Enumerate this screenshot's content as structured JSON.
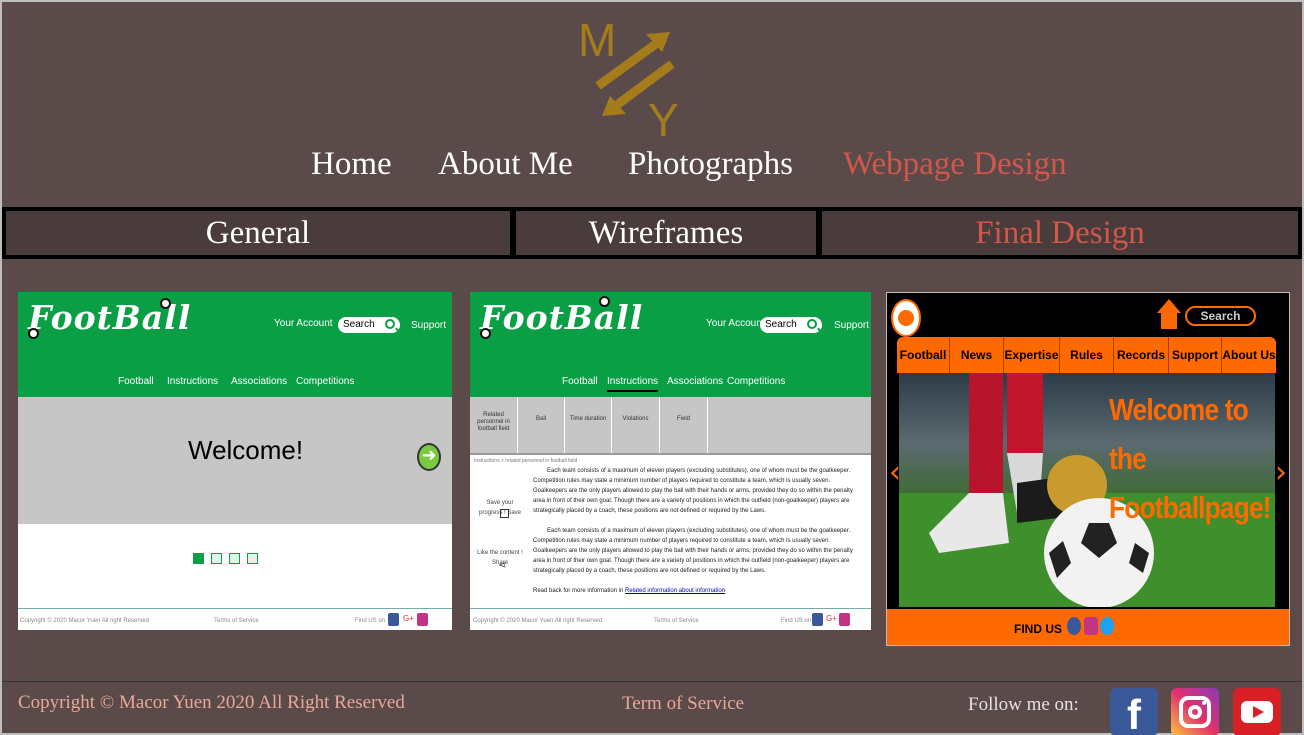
{
  "logo": {
    "letter_top": "M",
    "letter_bottom": "Y",
    "color": "#a57c1b"
  },
  "nav": [
    {
      "label": "Home",
      "active": false
    },
    {
      "label": "About Me",
      "active": false
    },
    {
      "label": "Photographs",
      "active": false
    },
    {
      "label": "Webpage Design",
      "active": true
    }
  ],
  "subtabs": [
    {
      "label": "General",
      "active": false
    },
    {
      "label": "Wireframes",
      "active": false
    },
    {
      "label": "Final Design",
      "active": true
    }
  ],
  "wireframe_common": {
    "brand": "FootBall",
    "account": "Your Account",
    "search": "Search",
    "support": "Support",
    "menu": [
      "Football",
      "Instructions",
      "Associations",
      "Competitions"
    ],
    "footer_copyright": "Copyright © 2020 Macor Yuen All right Reserved",
    "footer_terms": "Terms of Service",
    "footer_find": "Find US on"
  },
  "card1": {
    "welcome": "Welcome!"
  },
  "card2": {
    "table_headers": [
      "Related personnel in football field",
      "Ball",
      "Time duration",
      "Violations",
      "Field"
    ],
    "breadcrumb": "Instructions > related personnel in football field",
    "paragraph": "Each team consists of a maximum of eleven players (excluding substitutes), one of whom must be the goalkeeper. Competition rules may state a minimum number of players required to constitute a team, which is usually seven. Goalkeepers are the only players allowed to play the ball with their hands or arms, provided they do so within the penalty area in front of their own goal. Though there are a variety of positions in which the outfield (non-goalkeeper) players are strategically placed by a coach, these positions are not defined or required by the Laws.",
    "save_label": "Save your progress ! Save",
    "share_label": "Like the content ! Share",
    "read_back": "Read back for more information in",
    "read_link": "Related information about information"
  },
  "card3": {
    "search": "Search",
    "menu": [
      "Football",
      "News",
      "Expertise",
      "Rules",
      "Records",
      "Support",
      "About Us"
    ],
    "hero_line1": "Welcome to",
    "hero_line2": "the Footballpage!",
    "find_us": "FIND US",
    "accent": "#ff6a00"
  },
  "footer": {
    "copyright": "Copyright ©  Macor Yuen 2020 All Right Reserved",
    "terms": "Term of Service",
    "follow": "Follow me on:"
  },
  "icons": [
    "facebook-icon",
    "instagram-icon",
    "youtube-icon",
    "home-icon",
    "arrow-right-icon",
    "save-icon",
    "share-icon",
    "chevron-left-icon",
    "chevron-right-icon"
  ]
}
